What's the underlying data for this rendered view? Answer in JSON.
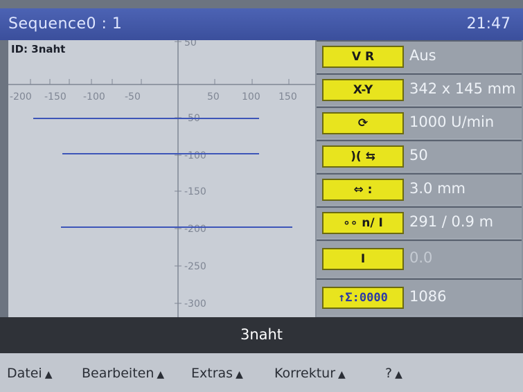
{
  "titlebar": {
    "title": "Sequence0 : 1",
    "clock": "21:47"
  },
  "plot": {
    "id_label": "ID: 3naht",
    "x_ticks": [
      "-200",
      "-150",
      "-100",
      "-50",
      "50",
      "100",
      "150"
    ],
    "y_ticks": [
      "50",
      "-50",
      "-100",
      "-150",
      "-200",
      "-250",
      "-300"
    ]
  },
  "panel": {
    "rows": [
      {
        "icon": "V R",
        "icon_name": "tool-icon",
        "value": "Aus"
      },
      {
        "icon": "X-Y",
        "icon_name": "xy-size-icon",
        "value": "342 x 145 mm"
      },
      {
        "icon": "⟳",
        "icon_name": "rotation-icon",
        "value": "1000 U/min"
      },
      {
        "icon": ")( ⇆",
        "icon_name": "gap-icon",
        "value": "50"
      },
      {
        "icon": "⇔ :",
        "icon_name": "spacing-icon",
        "value": "3.0 mm"
      },
      {
        "icon": "∘∘ n/ Ⅰ",
        "icon_name": "count-icon",
        "value": "291 / 0.9 m"
      },
      {
        "icon": "Ⅰ",
        "icon_name": "beam-icon",
        "value": "0.0"
      },
      {
        "icon": "↑Σ:0000",
        "icon_name": "sum-counter-icon",
        "value": "1086"
      }
    ]
  },
  "status": {
    "text": "3naht"
  },
  "menu": {
    "items": [
      {
        "label": "Datei"
      },
      {
        "label": "Bearbeiten"
      },
      {
        "label": "Extras"
      },
      {
        "label": "Korrektur"
      },
      {
        "label": "?"
      }
    ]
  }
}
